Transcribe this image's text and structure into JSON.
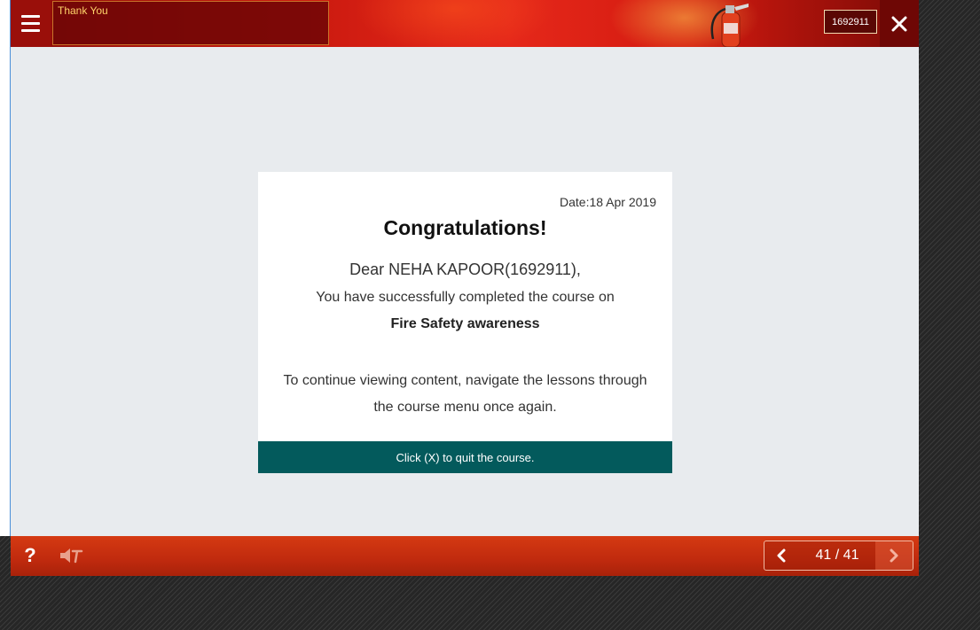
{
  "header": {
    "title": "Thank You",
    "user_id": "1692911",
    "menu_icon": "hamburger-menu-icon",
    "close_icon": "close-icon"
  },
  "card": {
    "date": "Date:18 Apr 2019",
    "heading": "Congratulations!",
    "greeting": "Dear NEHA KAPOOR(1692911),",
    "completed_text": "You have successfully completed the course on",
    "course_name": "Fire Safety awareness",
    "continue_line1": "To continue viewing content, navigate the lessons through",
    "continue_line2": "the course menu once again.",
    "quit_text": "Click (X) to quit the course."
  },
  "footer": {
    "help_label": "?",
    "page_counter": "41 / 41",
    "audio_icon": "audio-muted-icon",
    "prev_icon": "chevron-left-icon",
    "next_icon": "chevron-right-icon"
  },
  "colors": {
    "header_red": "#d31a10",
    "teal_bar": "#035a5c",
    "footer_red": "#c02a0e",
    "title_gold": "#ffd36a"
  }
}
